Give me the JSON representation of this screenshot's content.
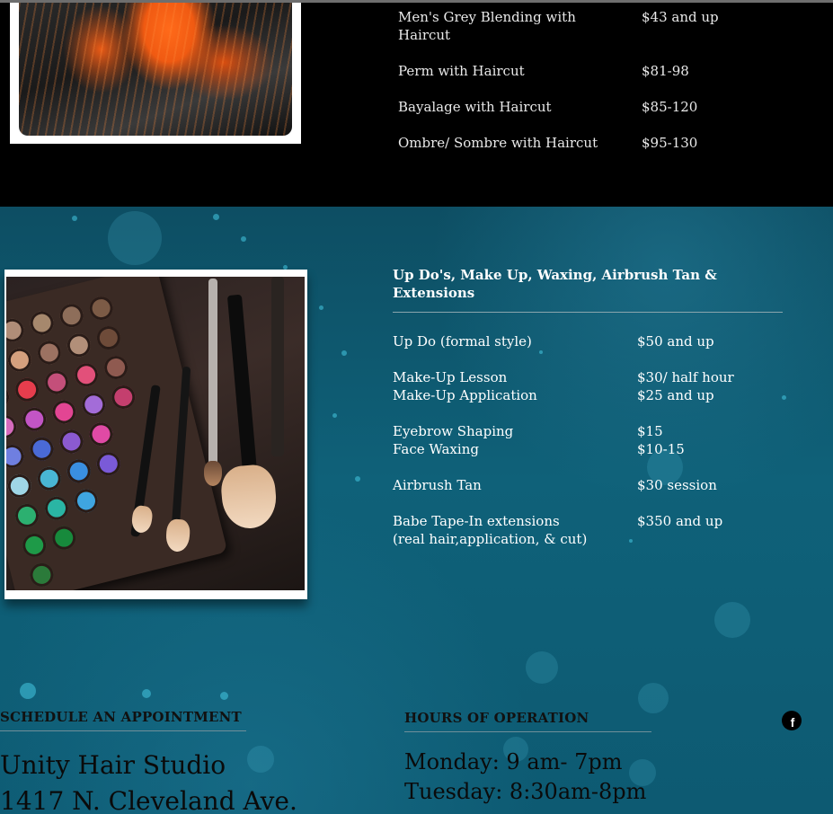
{
  "top_prices": [
    {
      "name": "Men's Grey Blending with Haircut",
      "price": "$43 and up"
    },
    {
      "name": "Perm with Haircut",
      "price": "$81-98"
    },
    {
      "name": "Bayalage with Haircut",
      "price": "$85-120"
    },
    {
      "name": "Ombre/ Sombre with Haircut",
      "price": "$95-130"
    }
  ],
  "services": {
    "title": "Up Do's, Make Up, Waxing, Airbrush Tan & Extensions",
    "items": [
      {
        "name": "Up Do (formal style)",
        "price": "$50 and up"
      },
      {
        "name": "Make-Up Lesson",
        "price": "$30/ half hour"
      },
      {
        "name": "Make-Up Application",
        "price": "$25 and up"
      },
      {
        "name": "Eyebrow Shaping",
        "price": "$15"
      },
      {
        "name": "Face Waxing",
        "price": "$10-15"
      },
      {
        "name": "Airbrush Tan",
        "price": "$30 session"
      },
      {
        "name": "Babe Tape-In extensions",
        "price": "$350 and up"
      },
      {
        "name": "(real hair,application, & cut)",
        "price": ""
      }
    ]
  },
  "footer": {
    "schedule_heading": "SCHEDULE AN APPOINTMENT",
    "studio_name": "Unity Hair Studio",
    "address_line": "1417 N. Cleveland Ave.",
    "hours_heading": "HOURS OF OPERATION",
    "hours": [
      "Monday: 9 am- 7pm",
      "Tuesday: 8:30am-8pm"
    ],
    "facebook_glyph": "f"
  },
  "colors": {
    "teal_background": "#0f6179",
    "black_background": "#000000"
  },
  "icons": {
    "social": "facebook-icon"
  }
}
